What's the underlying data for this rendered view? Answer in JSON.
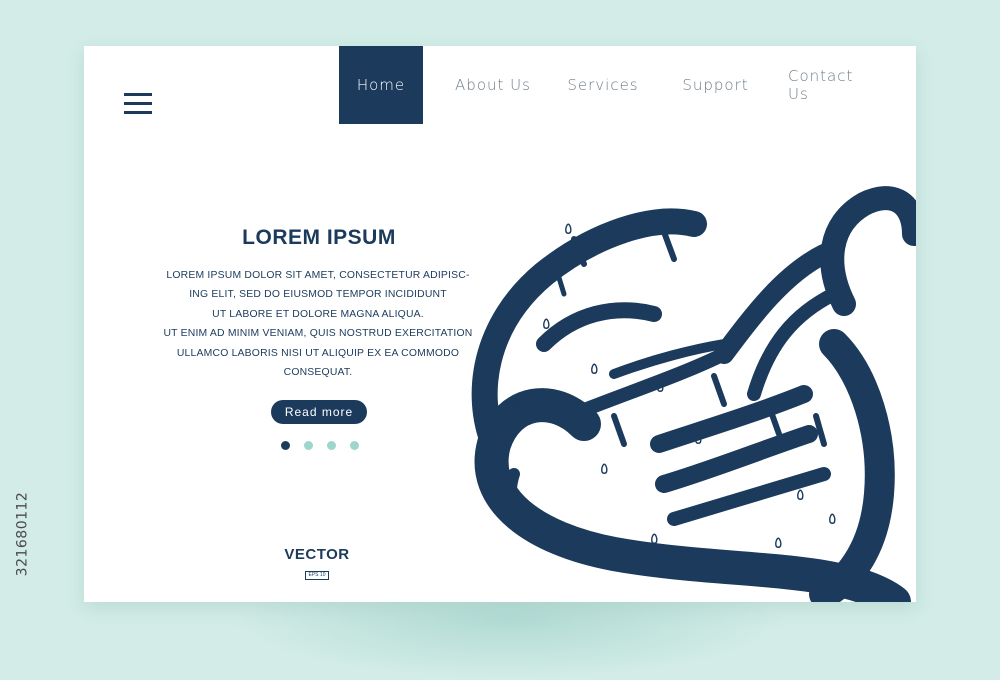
{
  "nav": {
    "items": [
      "Home",
      "About Us",
      "Services",
      "Support",
      "Contact Us"
    ]
  },
  "hero": {
    "title": "LOREM IPSUM",
    "body_lines": [
      "LOREM IPSUM DOLOR SIT AMET, CONSECTETUR ADIPISC-",
      "ING ELIT, SED DO EIUSMOD TEMPOR INCIDIDUNT",
      "UT LABORE ET DOLORE MAGNA ALIQUA.",
      "UT ENIM AD MINIM VENIAM, QUIS NOSTRUD EXERCITATION",
      "ULLAMCO LABORIS NISI UT ALIQUIP EX EA COMMODO",
      "CONSEQUAT."
    ],
    "button_label": "Read more",
    "slider": {
      "count": 4,
      "active": 1
    }
  },
  "logo": {
    "text": "VECTOR",
    "sub": "EPS 10"
  },
  "side_id": "321680112",
  "colors": {
    "navy": "#1b3a5c",
    "mint": "#9ed6ca",
    "background": "#d3ece7"
  },
  "icons": [
    "hamburger-menu-icon",
    "arabic-calligraphy-artwork"
  ]
}
